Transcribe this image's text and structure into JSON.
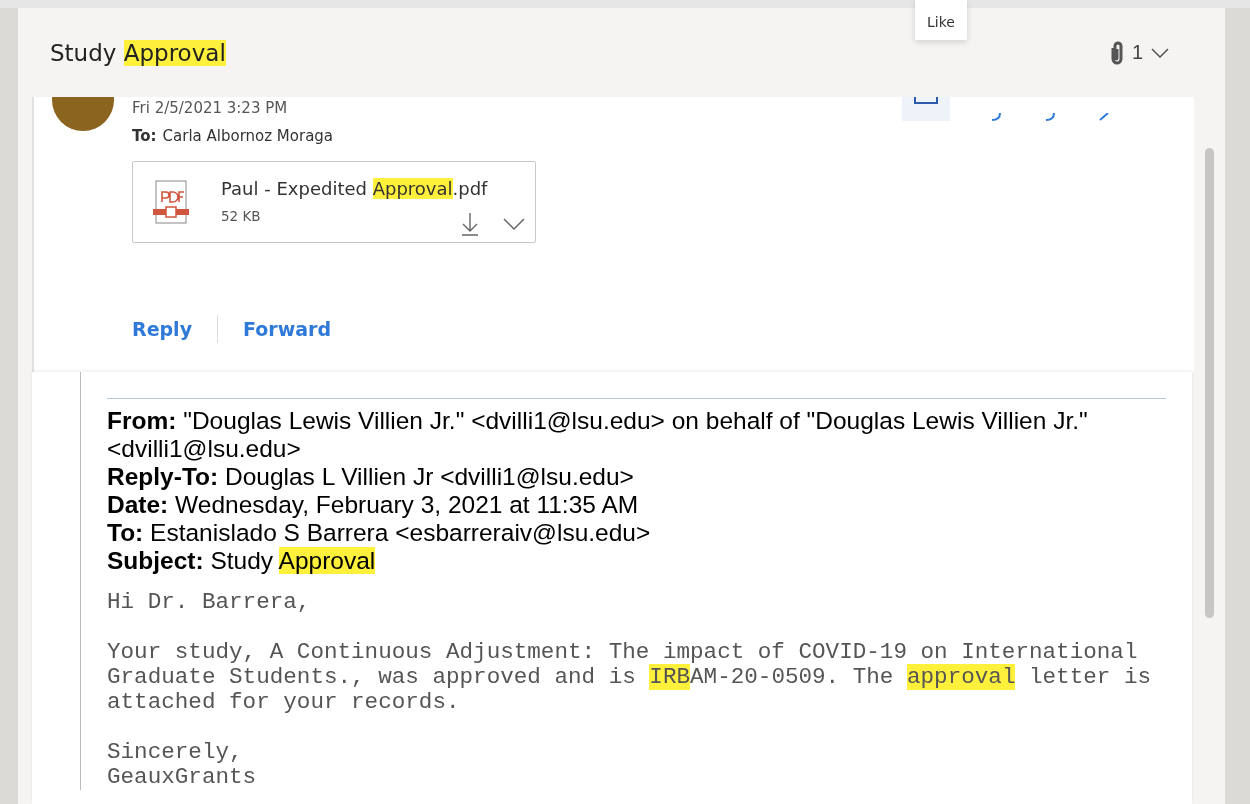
{
  "header": {
    "subject": [
      {
        "text": "Study ",
        "highlight": false
      },
      {
        "text": "Approval",
        "highlight": true
      }
    ],
    "tooltip": "Like",
    "attachment_count": "1"
  },
  "message": {
    "date": "Fri 2/5/2021 3:23 PM",
    "to_label": "To:",
    "to": "Carla Albornoz Moraga",
    "attachment": {
      "name": [
        {
          "text": "Paul - Expedited ",
          "highlight": false
        },
        {
          "text": "Approval",
          "highlight": true
        },
        {
          "text": ".pdf",
          "highlight": false
        }
      ],
      "size": "52 KB"
    },
    "actions": [
      "Reply",
      "Forward"
    ]
  },
  "quoted": {
    "headers": [
      {
        "label": "From:",
        "value": [
          {
            "text": "\"Douglas Lewis Villien Jr.\" <dvilli1@lsu.edu> on behalf of \"Douglas Lewis Villien Jr.\" <dvilli1@lsu.edu>",
            "highlight": false
          }
        ]
      },
      {
        "label": "Reply-To:",
        "value": [
          {
            "text": "Douglas L Villien Jr <dvilli1@lsu.edu>",
            "highlight": false
          }
        ]
      },
      {
        "label": "Date:",
        "value": [
          {
            "text": "Wednesday, February 3, 2021 at 11:35 AM",
            "highlight": false
          }
        ]
      },
      {
        "label": "To:",
        "value": [
          {
            "text": "Estanislado S Barrera <esbarreraiv@lsu.edu>",
            "highlight": false
          }
        ]
      },
      {
        "label": "Subject:",
        "value": [
          {
            "text": "Study ",
            "highlight": false
          },
          {
            "text": "Approval",
            "highlight": true
          }
        ]
      }
    ],
    "body": [
      {
        "lines": [
          [
            {
              "text": "Hi Dr. Barrera,",
              "highlight": false
            }
          ]
        ]
      },
      {
        "lines": [
          [
            {
              "text": "Your study, A Continuous Adjustment: The impact of COVID-19 on International",
              "highlight": false
            }
          ],
          [
            {
              "text": "Graduate Students., was approved and is ",
              "highlight": false
            },
            {
              "text": "IRB",
              "highlight": true
            },
            {
              "text": "AM-20-0509. The ",
              "highlight": false
            },
            {
              "text": "approval",
              "highlight": true
            },
            {
              "text": " letter is",
              "highlight": false
            }
          ],
          [
            {
              "text": "attached for your records.",
              "highlight": false
            }
          ]
        ]
      },
      {
        "lines": [
          [
            {
              "text": "Sincerely,",
              "highlight": false
            }
          ],
          [
            {
              "text": "GeauxGrants",
              "highlight": false
            }
          ]
        ]
      }
    ]
  }
}
